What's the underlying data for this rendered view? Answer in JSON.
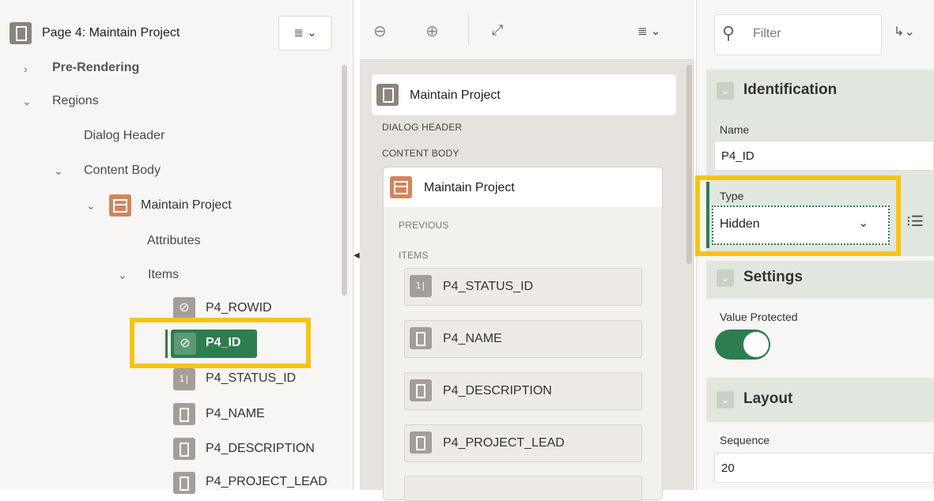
{
  "left_panel": {
    "page_title": "Page 4: Maintain Project",
    "tree": {
      "pre_rendering": "Pre-Rendering",
      "regions": "Regions",
      "dialog_header": "Dialog Header",
      "content_body": "Content Body",
      "maintain_project": "Maintain Project",
      "attributes": "Attributes",
      "items": "Items",
      "item_list": [
        "P4_ROWID",
        "P4_ID",
        "P4_STATUS_ID",
        "P4_NAME",
        "P4_DESCRIPTION",
        "P4_PROJECT_LEAD"
      ]
    },
    "menu_icon": "hamburger-dropdown-icon"
  },
  "middle_panel": {
    "page_card_title": "Maintain Project",
    "dialog_header": "DIALOG HEADER",
    "content_body": "CONTENT BODY",
    "region_title": "Maintain Project",
    "previous": "PREVIOUS",
    "items": "ITEMS",
    "item_cards": [
      "P4_STATUS_ID",
      "P4_NAME",
      "P4_DESCRIPTION",
      "P4_PROJECT_LEAD"
    ],
    "num_badge": "1"
  },
  "right_panel": {
    "filter_placeholder": "Filter",
    "sections": {
      "identification": "Identification",
      "settings": "Settings",
      "layout": "Layout"
    },
    "name_label": "Name",
    "name_value": "P4_ID",
    "type_label": "Type",
    "type_value": "Hidden",
    "value_protected_label": "Value Protected",
    "value_protected_on": true,
    "sequence_label": "Sequence",
    "sequence_value": "20"
  },
  "colors": {
    "accent_green": "#2e7d4f",
    "highlight_yellow": "#f6c414",
    "region_orange": "#d2855c"
  }
}
